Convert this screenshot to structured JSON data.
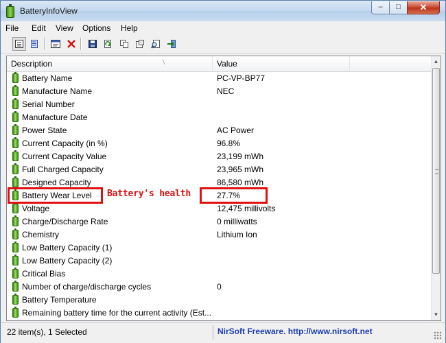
{
  "window": {
    "title": "BatteryInfoView"
  },
  "menu": [
    "File",
    "Edit",
    "View",
    "Options",
    "Help"
  ],
  "list": {
    "columns": [
      "Description",
      "Value"
    ],
    "rows": [
      {
        "desc": "Battery Name",
        "val": "PC-VP-BP77"
      },
      {
        "desc": "Manufacture Name",
        "val": "NEC"
      },
      {
        "desc": "Serial Number",
        "val": ""
      },
      {
        "desc": "Manufacture Date",
        "val": ""
      },
      {
        "desc": "Power State",
        "val": "AC Power"
      },
      {
        "desc": "Current Capacity (in %)",
        "val": "96.8%"
      },
      {
        "desc": "Current Capacity Value",
        "val": "23,199 mWh"
      },
      {
        "desc": "Full Charged Capacity",
        "val": "23,965 mWh"
      },
      {
        "desc": "Designed Capacity",
        "val": "86,580 mWh"
      },
      {
        "desc": "Battery Wear Level",
        "val": "27.7%"
      },
      {
        "desc": "Voltage",
        "val": "12,475 millivolts"
      },
      {
        "desc": "Charge/Discharge Rate",
        "val": "0 milliwatts"
      },
      {
        "desc": "Chemistry",
        "val": "Lithium Ion"
      },
      {
        "desc": "Low Battery Capacity (1)",
        "val": ""
      },
      {
        "desc": "Low Battery Capacity (2)",
        "val": ""
      },
      {
        "desc": "Critical Bias",
        "val": ""
      },
      {
        "desc": "Number of charge/discharge cycles",
        "val": "0"
      },
      {
        "desc": "Battery Temperature",
        "val": ""
      },
      {
        "desc": "Remaining battery time for the current activity (Est...",
        "val": ""
      }
    ]
  },
  "annotation": {
    "text": "Battery's health",
    "color": "#e01010"
  },
  "status": {
    "items": "22 item(s), 1 Selected",
    "credit": "NirSoft Freeware.  http://www.nirsoft.net"
  }
}
